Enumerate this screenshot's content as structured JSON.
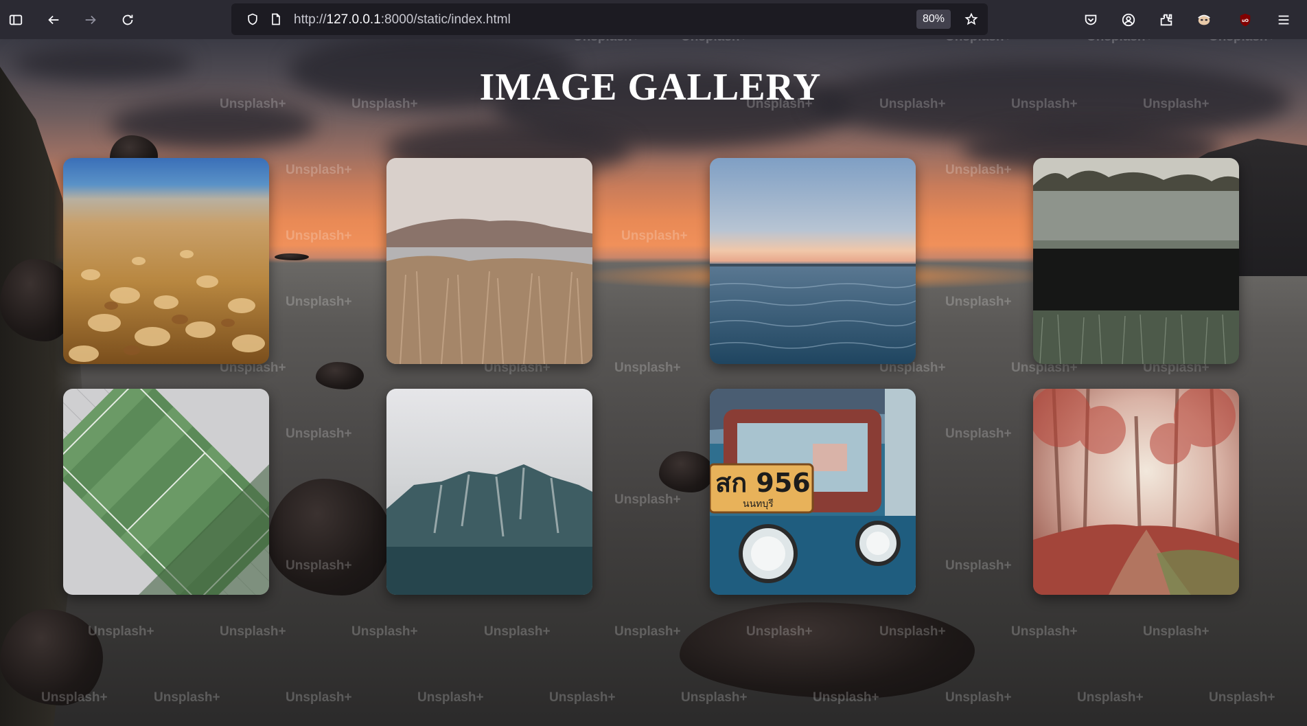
{
  "browser": {
    "url_prefix": "http://",
    "url_host": "127.0.0.1",
    "url_rest": ":8000/static/index.html",
    "zoom": "80%"
  },
  "page": {
    "title": "IMAGE GALLERY",
    "watermark": "Unsplash+"
  },
  "gallery": [
    {
      "subject": "pebbles on a beach"
    },
    {
      "subject": "dry grass by a lake"
    },
    {
      "subject": "calm sea at dusk"
    },
    {
      "subject": "frosty field"
    },
    {
      "subject": "aerial football pitch"
    },
    {
      "subject": "misty mountain"
    },
    {
      "subject": "tuk-tuk front with plate",
      "plate_number": "สก 956",
      "plate_province": "นนทบุรี"
    },
    {
      "subject": "autumn forest path"
    }
  ],
  "colors": {
    "toolbar_bg": "#2b2a33",
    "urlbar_bg": "#1c1b22",
    "sunset_orange": "#f0905a"
  }
}
